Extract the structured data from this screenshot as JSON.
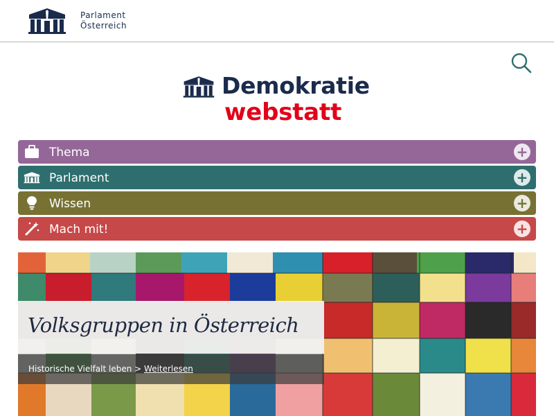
{
  "header": {
    "logo_line1": "Parlament",
    "logo_line2": "Österreich"
  },
  "search": {
    "icon": "search-icon"
  },
  "brand": {
    "title": "Demokratie",
    "subtitle": "webstatt",
    "title_color": "#1a2b4c",
    "subtitle_color": "#e2001a"
  },
  "menu": {
    "items": [
      {
        "label": "Thema",
        "icon": "briefcase-icon",
        "color": "#956798"
      },
      {
        "label": "Parlament",
        "icon": "parliament-icon",
        "color": "#2e6e6e"
      },
      {
        "label": "Wissen",
        "icon": "lightbulb-icon",
        "color": "#777234"
      },
      {
        "label": "Mach mit!",
        "icon": "magic-wand-icon",
        "color": "#c74848"
      }
    ],
    "expand_symbol": "+"
  },
  "hero": {
    "title": "Volksgruppen in Österreich",
    "teaser_text": "Historische Vielfalt leben >",
    "teaser_link": "Weiterlesen"
  }
}
